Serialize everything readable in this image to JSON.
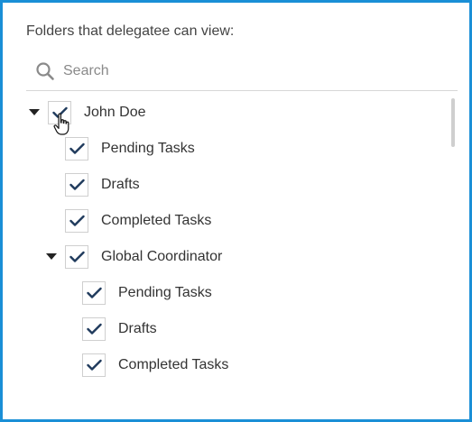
{
  "panel": {
    "title": "Folders that delegatee can view:"
  },
  "search": {
    "placeholder": "Search",
    "value": ""
  },
  "tree": {
    "root": {
      "label": "John Doe",
      "checked": true,
      "expanded": true,
      "children": [
        {
          "label": "Pending Tasks",
          "checked": true
        },
        {
          "label": "Drafts",
          "checked": true
        },
        {
          "label": "Completed Tasks",
          "checked": true
        },
        {
          "label": "Global Coordinator",
          "checked": true,
          "expanded": true,
          "children": [
            {
              "label": "Pending Tasks",
              "checked": true
            },
            {
              "label": "Drafts",
              "checked": true
            },
            {
              "label": "Completed Tasks",
              "checked": true
            }
          ]
        }
      ]
    }
  },
  "colors": {
    "frame_border": "#1a8fd6",
    "checkmark": "#1f3a5c",
    "text": "#333333"
  },
  "icons": {
    "search": "search-icon",
    "checkmark": "checkmark-icon",
    "expand": "caret-down-icon",
    "pointer": "hand-cursor-icon"
  }
}
